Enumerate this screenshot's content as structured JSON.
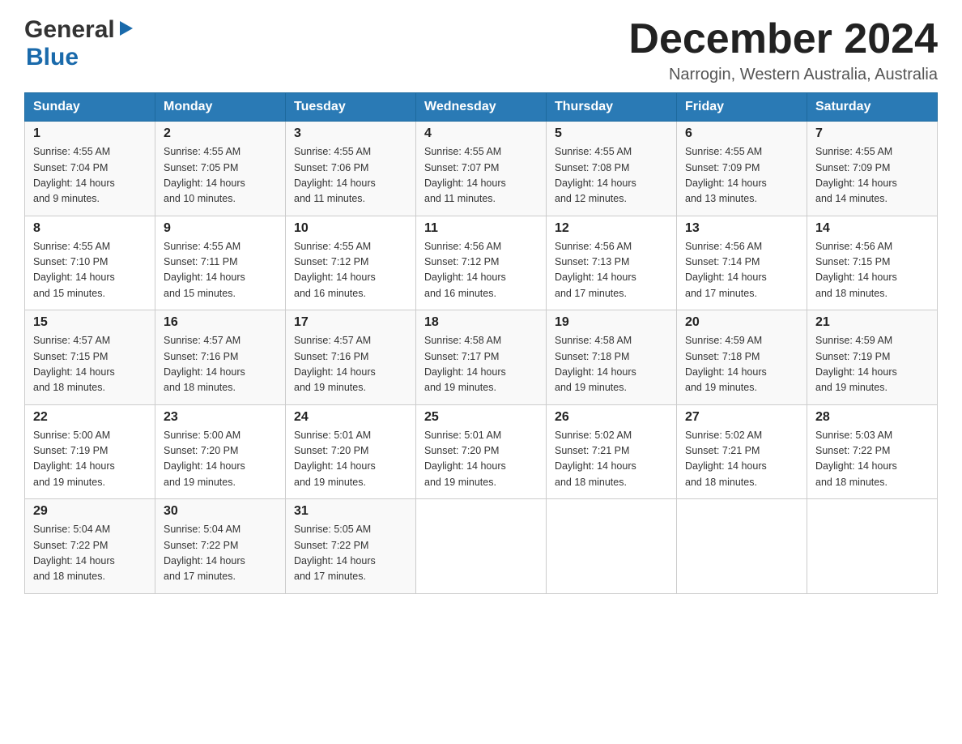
{
  "header": {
    "logo": {
      "general": "General",
      "blue": "Blue",
      "arrow": "▶"
    },
    "title": "December 2024",
    "subtitle": "Narrogin, Western Australia, Australia"
  },
  "calendar": {
    "days": [
      "Sunday",
      "Monday",
      "Tuesday",
      "Wednesday",
      "Thursday",
      "Friday",
      "Saturday"
    ],
    "weeks": [
      [
        {
          "num": "1",
          "sunrise": "4:55 AM",
          "sunset": "7:04 PM",
          "daylight": "14 hours and 9 minutes."
        },
        {
          "num": "2",
          "sunrise": "4:55 AM",
          "sunset": "7:05 PM",
          "daylight": "14 hours and 10 minutes."
        },
        {
          "num": "3",
          "sunrise": "4:55 AM",
          "sunset": "7:06 PM",
          "daylight": "14 hours and 11 minutes."
        },
        {
          "num": "4",
          "sunrise": "4:55 AM",
          "sunset": "7:07 PM",
          "daylight": "14 hours and 11 minutes."
        },
        {
          "num": "5",
          "sunrise": "4:55 AM",
          "sunset": "7:08 PM",
          "daylight": "14 hours and 12 minutes."
        },
        {
          "num": "6",
          "sunrise": "4:55 AM",
          "sunset": "7:09 PM",
          "daylight": "14 hours and 13 minutes."
        },
        {
          "num": "7",
          "sunrise": "4:55 AM",
          "sunset": "7:09 PM",
          "daylight": "14 hours and 14 minutes."
        }
      ],
      [
        {
          "num": "8",
          "sunrise": "4:55 AM",
          "sunset": "7:10 PM",
          "daylight": "14 hours and 15 minutes."
        },
        {
          "num": "9",
          "sunrise": "4:55 AM",
          "sunset": "7:11 PM",
          "daylight": "14 hours and 15 minutes."
        },
        {
          "num": "10",
          "sunrise": "4:55 AM",
          "sunset": "7:12 PM",
          "daylight": "14 hours and 16 minutes."
        },
        {
          "num": "11",
          "sunrise": "4:56 AM",
          "sunset": "7:12 PM",
          "daylight": "14 hours and 16 minutes."
        },
        {
          "num": "12",
          "sunrise": "4:56 AM",
          "sunset": "7:13 PM",
          "daylight": "14 hours and 17 minutes."
        },
        {
          "num": "13",
          "sunrise": "4:56 AM",
          "sunset": "7:14 PM",
          "daylight": "14 hours and 17 minutes."
        },
        {
          "num": "14",
          "sunrise": "4:56 AM",
          "sunset": "7:15 PM",
          "daylight": "14 hours and 18 minutes."
        }
      ],
      [
        {
          "num": "15",
          "sunrise": "4:57 AM",
          "sunset": "7:15 PM",
          "daylight": "14 hours and 18 minutes."
        },
        {
          "num": "16",
          "sunrise": "4:57 AM",
          "sunset": "7:16 PM",
          "daylight": "14 hours and 18 minutes."
        },
        {
          "num": "17",
          "sunrise": "4:57 AM",
          "sunset": "7:16 PM",
          "daylight": "14 hours and 19 minutes."
        },
        {
          "num": "18",
          "sunrise": "4:58 AM",
          "sunset": "7:17 PM",
          "daylight": "14 hours and 19 minutes."
        },
        {
          "num": "19",
          "sunrise": "4:58 AM",
          "sunset": "7:18 PM",
          "daylight": "14 hours and 19 minutes."
        },
        {
          "num": "20",
          "sunrise": "4:59 AM",
          "sunset": "7:18 PM",
          "daylight": "14 hours and 19 minutes."
        },
        {
          "num": "21",
          "sunrise": "4:59 AM",
          "sunset": "7:19 PM",
          "daylight": "14 hours and 19 minutes."
        }
      ],
      [
        {
          "num": "22",
          "sunrise": "5:00 AM",
          "sunset": "7:19 PM",
          "daylight": "14 hours and 19 minutes."
        },
        {
          "num": "23",
          "sunrise": "5:00 AM",
          "sunset": "7:20 PM",
          "daylight": "14 hours and 19 minutes."
        },
        {
          "num": "24",
          "sunrise": "5:01 AM",
          "sunset": "7:20 PM",
          "daylight": "14 hours and 19 minutes."
        },
        {
          "num": "25",
          "sunrise": "5:01 AM",
          "sunset": "7:20 PM",
          "daylight": "14 hours and 19 minutes."
        },
        {
          "num": "26",
          "sunrise": "5:02 AM",
          "sunset": "7:21 PM",
          "daylight": "14 hours and 18 minutes."
        },
        {
          "num": "27",
          "sunrise": "5:02 AM",
          "sunset": "7:21 PM",
          "daylight": "14 hours and 18 minutes."
        },
        {
          "num": "28",
          "sunrise": "5:03 AM",
          "sunset": "7:22 PM",
          "daylight": "14 hours and 18 minutes."
        }
      ],
      [
        {
          "num": "29",
          "sunrise": "5:04 AM",
          "sunset": "7:22 PM",
          "daylight": "14 hours and 18 minutes."
        },
        {
          "num": "30",
          "sunrise": "5:04 AM",
          "sunset": "7:22 PM",
          "daylight": "14 hours and 17 minutes."
        },
        {
          "num": "31",
          "sunrise": "5:05 AM",
          "sunset": "7:22 PM",
          "daylight": "14 hours and 17 minutes."
        },
        null,
        null,
        null,
        null
      ]
    ],
    "labels": {
      "sunrise": "Sunrise:",
      "sunset": "Sunset:",
      "daylight": "Daylight:"
    }
  }
}
